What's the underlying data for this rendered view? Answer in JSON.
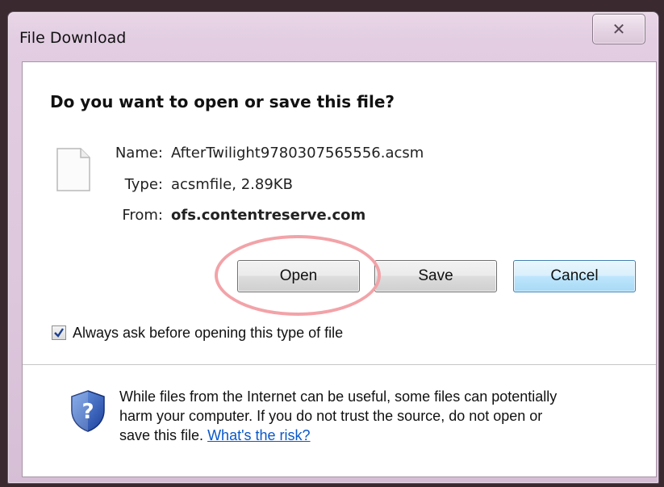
{
  "window": {
    "title": "File Download",
    "close_glyph": "✕"
  },
  "dialog": {
    "question": "Do you want to open or save this file?",
    "file": {
      "icon": "blank-document-icon",
      "name_label": "Name:",
      "name_value": "AfterTwilight9780307565556.acsm",
      "type_label": "Type:",
      "type_value": "acsmfile, 2.89KB",
      "from_label": "From:",
      "from_value": "ofs.contentreserve.com"
    },
    "buttons": {
      "open": "Open",
      "save": "Save",
      "cancel": "Cancel"
    },
    "always_ask": {
      "label": "Always ask before opening this type of file",
      "checked": true
    },
    "warning": {
      "icon": "security-shield-question-icon",
      "line1": "While files from the Internet can be useful, some files can potentially",
      "line2": "harm your computer. If you do not trust the source, do not open or",
      "line3_text": "save this file.",
      "link": "What's the risk?"
    }
  },
  "colors": {
    "default_button_border": "#3c7fb1",
    "highlight_ellipse": "#f2a3a8",
    "link": "#0a58c7"
  }
}
